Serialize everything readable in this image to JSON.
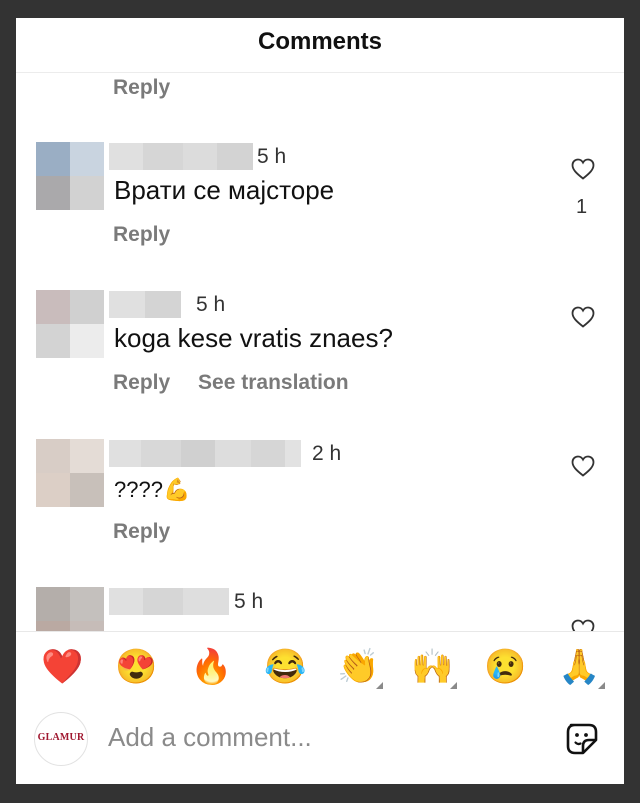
{
  "header": {
    "title": "Comments"
  },
  "top_reply_label": "Reply",
  "comments": [
    {
      "time": "5 h",
      "text": "Врати се мајсторе",
      "actions": [
        "Reply"
      ],
      "likes": "1"
    },
    {
      "time": "5 h",
      "text": "koga kese vratis znaes?",
      "actions": [
        "Reply",
        "See translation"
      ],
      "likes": ""
    },
    {
      "time": "2 h",
      "text": "????💪",
      "actions": [
        "Reply"
      ],
      "likes": ""
    },
    {
      "time": "5 h",
      "text": "",
      "actions": [],
      "likes": ""
    }
  ],
  "reactions": [
    {
      "name": "red-heart",
      "glyph": "❤️"
    },
    {
      "name": "heart-eyes",
      "glyph": "😍"
    },
    {
      "name": "fire",
      "glyph": "🔥"
    },
    {
      "name": "tears-of-joy",
      "glyph": "😂"
    },
    {
      "name": "clapping-hands",
      "glyph": "👏"
    },
    {
      "name": "raising-hands",
      "glyph": "🙌"
    },
    {
      "name": "crying-face",
      "glyph": "😢"
    },
    {
      "name": "folded-hands",
      "glyph": "🙏"
    }
  ],
  "composer": {
    "avatar_brand": "GLAMUR",
    "placeholder": "Add a comment...",
    "sticker_icon": "sticker-icon"
  },
  "colors": {
    "background": "#333333",
    "panel": "#ffffff",
    "muted_text": "#7a7a7a",
    "brand": "#a01830"
  }
}
